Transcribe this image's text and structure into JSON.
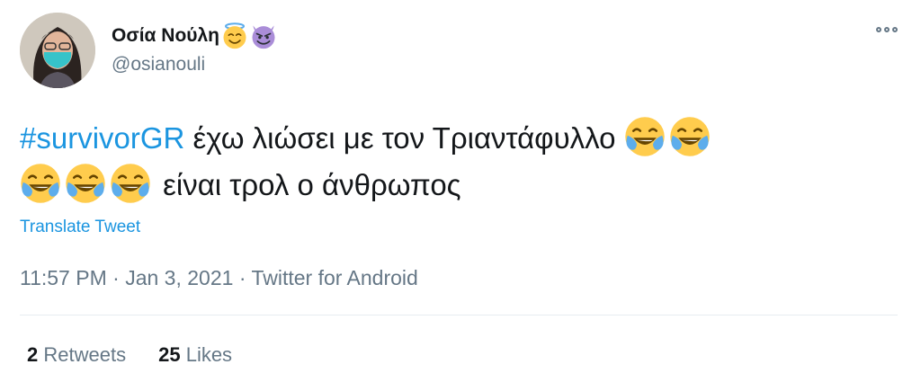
{
  "author": {
    "display_name": "Οσία Νούλη",
    "handle": "@osianouli",
    "name_emojis": [
      "smiling-face-with-halo",
      "smiling-face-with-horns"
    ]
  },
  "tweet": {
    "hashtag": "#survivorGR",
    "text_line1": " έχω λιώσει με τον Τριαντάφυλλο ",
    "text_line2": " είναι τρολ ο άνθρωπος",
    "emoji": "face-with-tears-of-joy"
  },
  "translate_label": "Translate Tweet",
  "meta": {
    "time": "11:57 PM",
    "separator": "·",
    "date": "Jan 3, 2021",
    "source": "Twitter for Android"
  },
  "stats": {
    "retweets_count": "2",
    "retweets_label": "Retweets",
    "likes_count": "25",
    "likes_label": "Likes"
  },
  "colors": {
    "link": "#1b95e0",
    "secondary_text": "#657786",
    "primary_text": "#14171a",
    "divider": "#e6ecf0"
  }
}
